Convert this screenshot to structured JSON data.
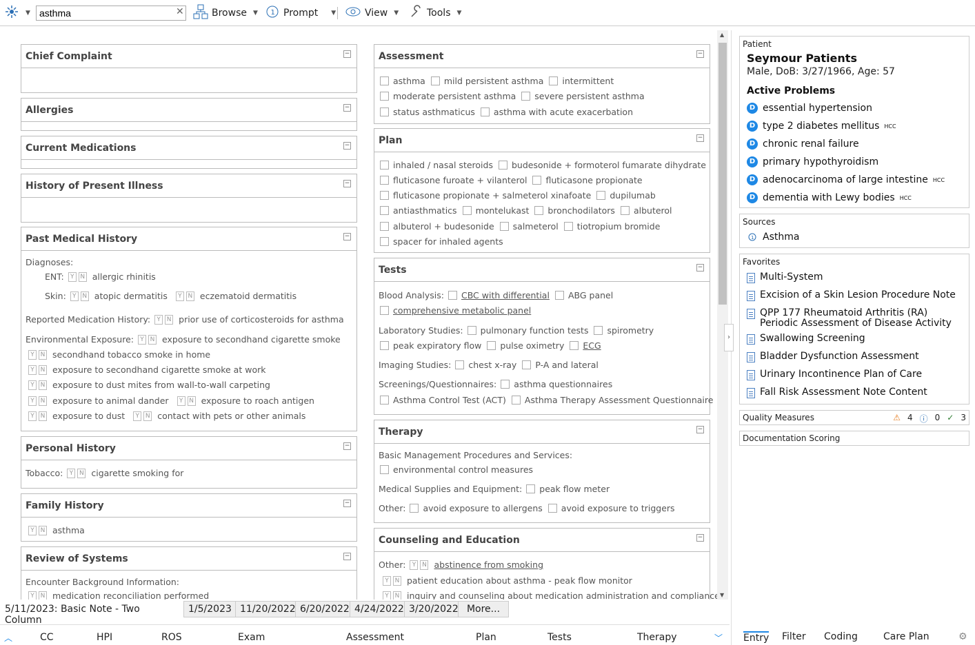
{
  "toolbar": {
    "search_value": "asthma",
    "browse": "Browse",
    "prompt": "Prompt",
    "view": "View",
    "tools": "Tools"
  },
  "sections": {
    "chief_complaint": "Chief Complaint",
    "allergies": "Allergies",
    "current_medications": "Current Medications",
    "hpi": "History of Present Illness",
    "pmh": {
      "title": "Past Medical History",
      "diagnoses": "Diagnoses:",
      "ent": "ENT:",
      "allergic_rhinitis": "allergic rhinitis",
      "skin": "Skin:",
      "atopic_dermatitis": "atopic dermatitis",
      "eczematoid_dermatitis": "eczematoid dermatitis",
      "reported_med_history": "Reported Medication History:",
      "prior_corticosteroids": "prior use of corticosteroids for asthma",
      "env_exposure": "Environmental Exposure:",
      "secondhand_smoke": "exposure to secondhand cigarette smoke",
      "secondhand_tobacco_home": "secondhand tobacco smoke in home",
      "secondhand_work": "exposure to secondhand cigarette smoke at work",
      "dust_mites": "exposure to dust mites from wall-to-wall carpeting",
      "animal_dander": "exposure to animal dander",
      "roach_antigen": "exposure to roach antigen",
      "dust": "exposure to dust",
      "pets": "contact with pets or other animals"
    },
    "personal_history": {
      "title": "Personal History",
      "tobacco": "Tobacco:",
      "cigarette": "cigarette smoking for"
    },
    "family_history": {
      "title": "Family History",
      "asthma": "asthma"
    },
    "ros": {
      "title": "Review of Systems",
      "encounter_bg": "Encounter Background Information:",
      "med_rec": "medication reconciliation performed"
    },
    "assessment": {
      "title": "Assessment",
      "items": [
        "asthma",
        "mild persistent asthma",
        "intermittent",
        "moderate persistent asthma",
        "severe persistent asthma",
        "status asthmaticus",
        "asthma with acute exacerbation"
      ]
    },
    "plan": {
      "title": "Plan",
      "items": [
        "inhaled / nasal steroids",
        "budesonide + formoterol fumarate dihydrate",
        "fluticasone furoate + vilanterol",
        "fluticasone propionate",
        "fluticasone propionate + salmeterol xinafoate",
        "dupilumab",
        "antiasthmatics",
        "montelukast",
        "bronchodilators",
        "albuterol",
        "albuterol + budesonide",
        "salmeterol",
        "tiotropium bromide",
        "spacer for inhaled agents"
      ]
    },
    "tests": {
      "title": "Tests",
      "blood": "Blood Analysis:",
      "cbc": "CBC with differential",
      "abg": "ABG panel",
      "cmp": "comprehensive metabolic panel",
      "lab": "Laboratory Studies:",
      "pft": "pulmonary function tests",
      "spirometry": "spirometry",
      "pef": "peak expiratory flow",
      "pulse_ox": "pulse oximetry",
      "ecg": "ECG",
      "imaging": "Imaging Studies:",
      "cxr": "chest x-ray",
      "pa_lat": "P-A and lateral",
      "screenings": "Screenings/Questionnaires:",
      "asthma_q": "asthma questionnaires",
      "act": "Asthma Control Test (ACT)",
      "ataq": "Asthma Therapy Assessment Questionnaire"
    },
    "therapy": {
      "title": "Therapy",
      "basic": "Basic Management Procedures and Services:",
      "env_control": "environmental control measures",
      "supplies": "Medical Supplies and Equipment:",
      "peak_flow_meter": "peak flow meter",
      "other": "Other:",
      "avoid_allergens": "avoid exposure to allergens",
      "avoid_triggers": "avoid exposure to triggers"
    },
    "counseling": {
      "title": "Counseling and Education",
      "other": "Other:",
      "abstinence": "abstinence from smoking",
      "education": "patient education about asthma - peak flow monitor",
      "inquiry": "inquiry and counseling about medication administration and compliance"
    }
  },
  "patient": {
    "label": "Patient",
    "name": "Seymour Patients",
    "info": "Male, DoB: 3/27/1966, Age: 57",
    "active_problems": "Active Problems",
    "problems": [
      {
        "name": "essential hypertension",
        "hcc": ""
      },
      {
        "name": "type 2 diabetes mellitus",
        "hcc": "HCC"
      },
      {
        "name": "chronic renal failure",
        "hcc": ""
      },
      {
        "name": "primary hypothyroidism",
        "hcc": ""
      },
      {
        "name": "adenocarcinoma of large intestine",
        "hcc": "HCC"
      },
      {
        "name": "dementia with Lewy bodies",
        "hcc": "HCC"
      }
    ]
  },
  "sources": {
    "label": "Sources",
    "item": "Asthma"
  },
  "favorites": {
    "label": "Favorites",
    "items": [
      "Multi-System",
      "Excision of a Skin Lesion Procedure Note",
      "QPP 177 Rheumatoid Arthritis (RA) Periodic Assessment of Disease Activity",
      "Swallowing Screening",
      "Bladder Dysfunction Assessment",
      "Urinary Incontinence Plan of Care",
      "Fall Risk Assessment Note Content"
    ]
  },
  "quality": {
    "label": "Quality Measures",
    "warn": "4",
    "info": "0",
    "ok": "3"
  },
  "doc_scoring": "Documentation Scoring",
  "note_tabs": {
    "active": "5/11/2023: Basic Note - Two Column",
    "dates": [
      "1/5/2023",
      "11/20/2022",
      "6/20/2022",
      "4/24/2022",
      "3/20/2022"
    ],
    "more": "More..."
  },
  "nav": [
    "CC",
    "HPI",
    "ROS",
    "Exam",
    "Assessment",
    "Plan",
    "Tests",
    "Therapy"
  ],
  "right_nav": [
    "Entry",
    "Filter",
    "Coding",
    "Care Plan"
  ],
  "y_label": "Y",
  "n_label": "N",
  "colors": {
    "accent": "#1e88e5",
    "active_tab": "#1e88e5"
  }
}
